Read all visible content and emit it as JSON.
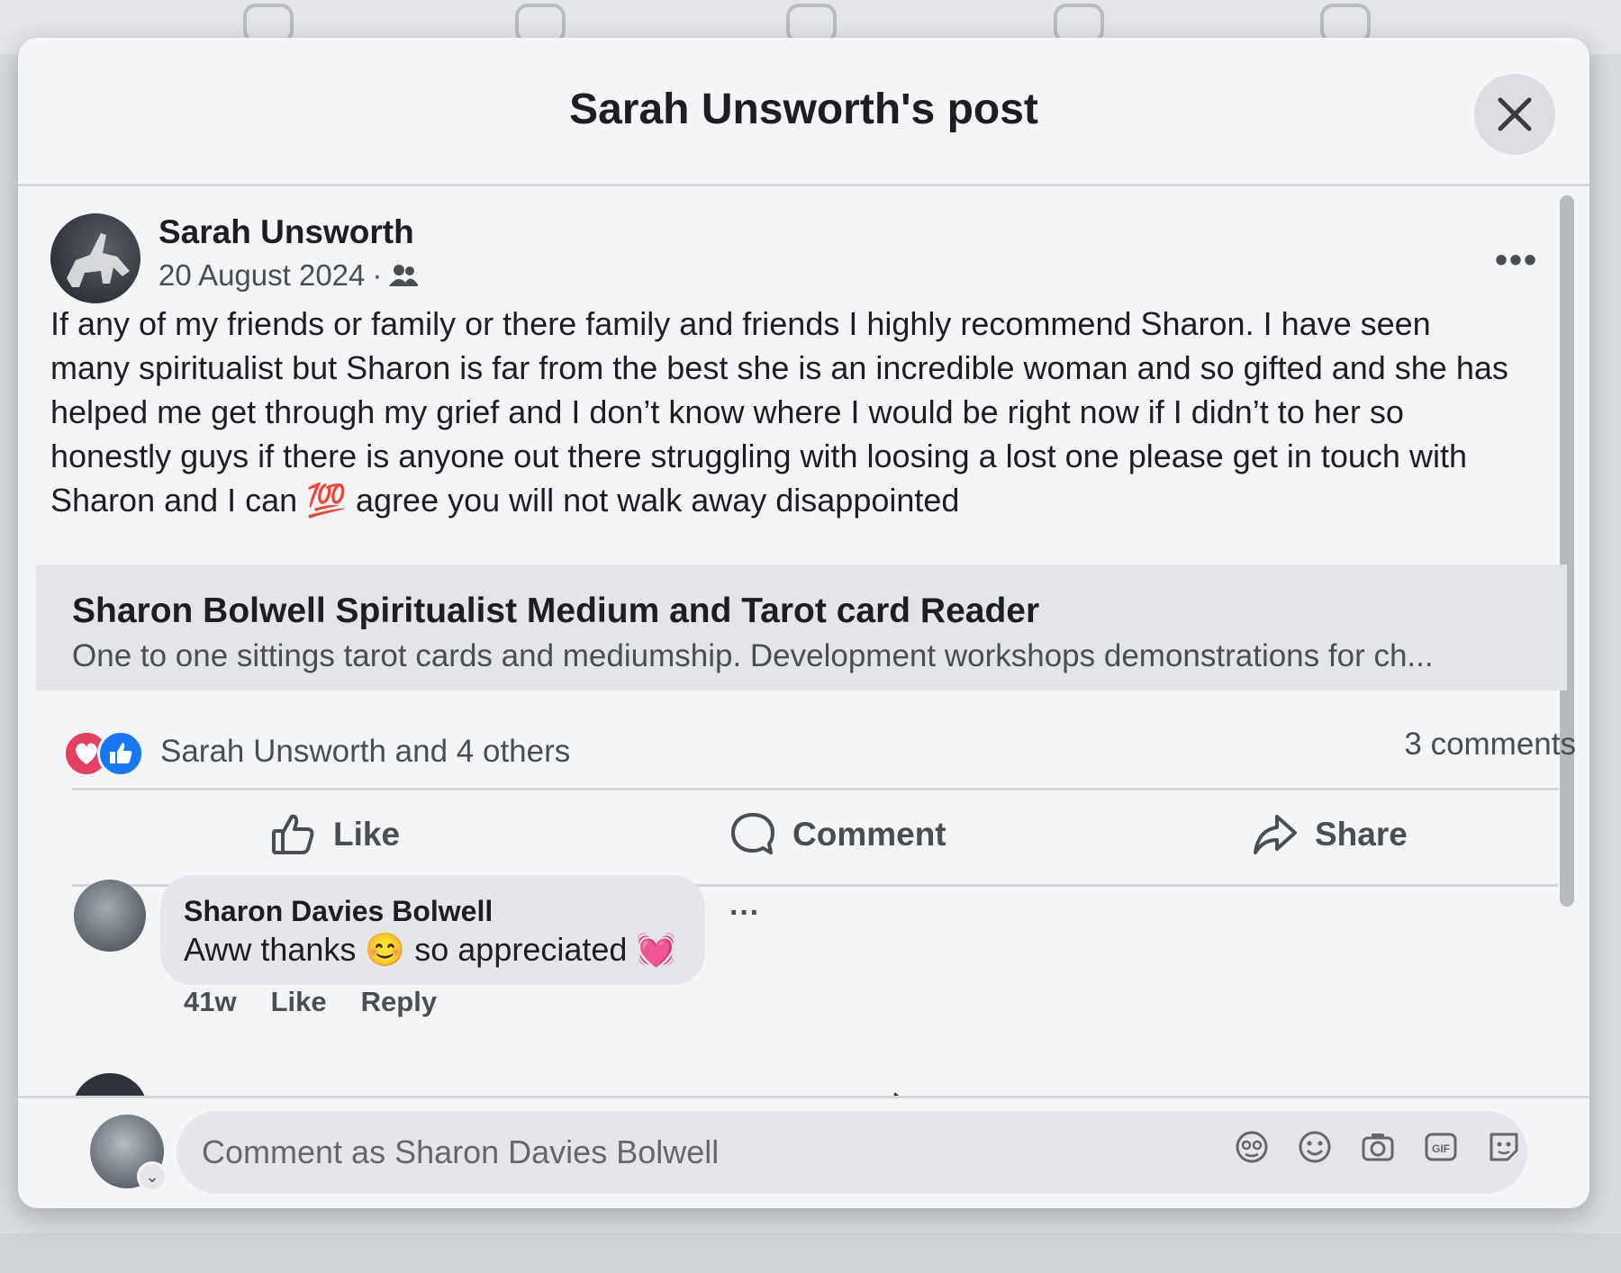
{
  "modal": {
    "title": "Sarah Unsworth's post",
    "close_icon": "close-icon"
  },
  "post": {
    "author": "Sarah Unsworth",
    "date": "20 August 2024",
    "separator": "·",
    "audience_icon": "friends-icon",
    "more_icon": "more-options-icon",
    "text_lines": [
      "If any of my friends or family or there family and friends I highly recommend Sharon. I have seen",
      "many spiritualist but Sharon is far from the best she is an incredible woman and so gifted and she has",
      "helped me get through my grief and I don’t know where I would be right now if I didn’t to her so",
      "honestly guys if there is anyone out there struggling with loosing a lost one please get in touch with",
      "Sharon and I can 💯 agree you will not walk away disappointed"
    ],
    "link_preview": {
      "title": "Sharon Bolwell Spiritualist Medium and Tarot card Reader",
      "description": "One to one sittings tarot cards and mediumship. Development workshops demonstrations for ch..."
    },
    "reactions": {
      "icons": [
        "love-reaction-icon",
        "like-reaction-icon"
      ],
      "summary": "Sarah Unsworth and 4 others",
      "comment_count": "3 comments"
    },
    "actions": {
      "like": "Like",
      "comment": "Comment",
      "share": "Share"
    }
  },
  "comments": [
    {
      "author": "Sharon Davies Bolwell",
      "text": "Aww thanks 😊 so appreciated 💓",
      "time": "41w",
      "like": "Like",
      "reply": "Reply"
    }
  ],
  "composer": {
    "placeholder": "Comment as Sharon Davies Bolwell",
    "icons": [
      "avatar-sticker-icon",
      "emoji-icon",
      "camera-icon",
      "gif-icon",
      "sticker-icon"
    ]
  },
  "colors": {
    "love": "#e4405f",
    "like": "#1877f2",
    "modal_bg": "#f4f5f6",
    "secondary_text": "#4a4d52"
  }
}
